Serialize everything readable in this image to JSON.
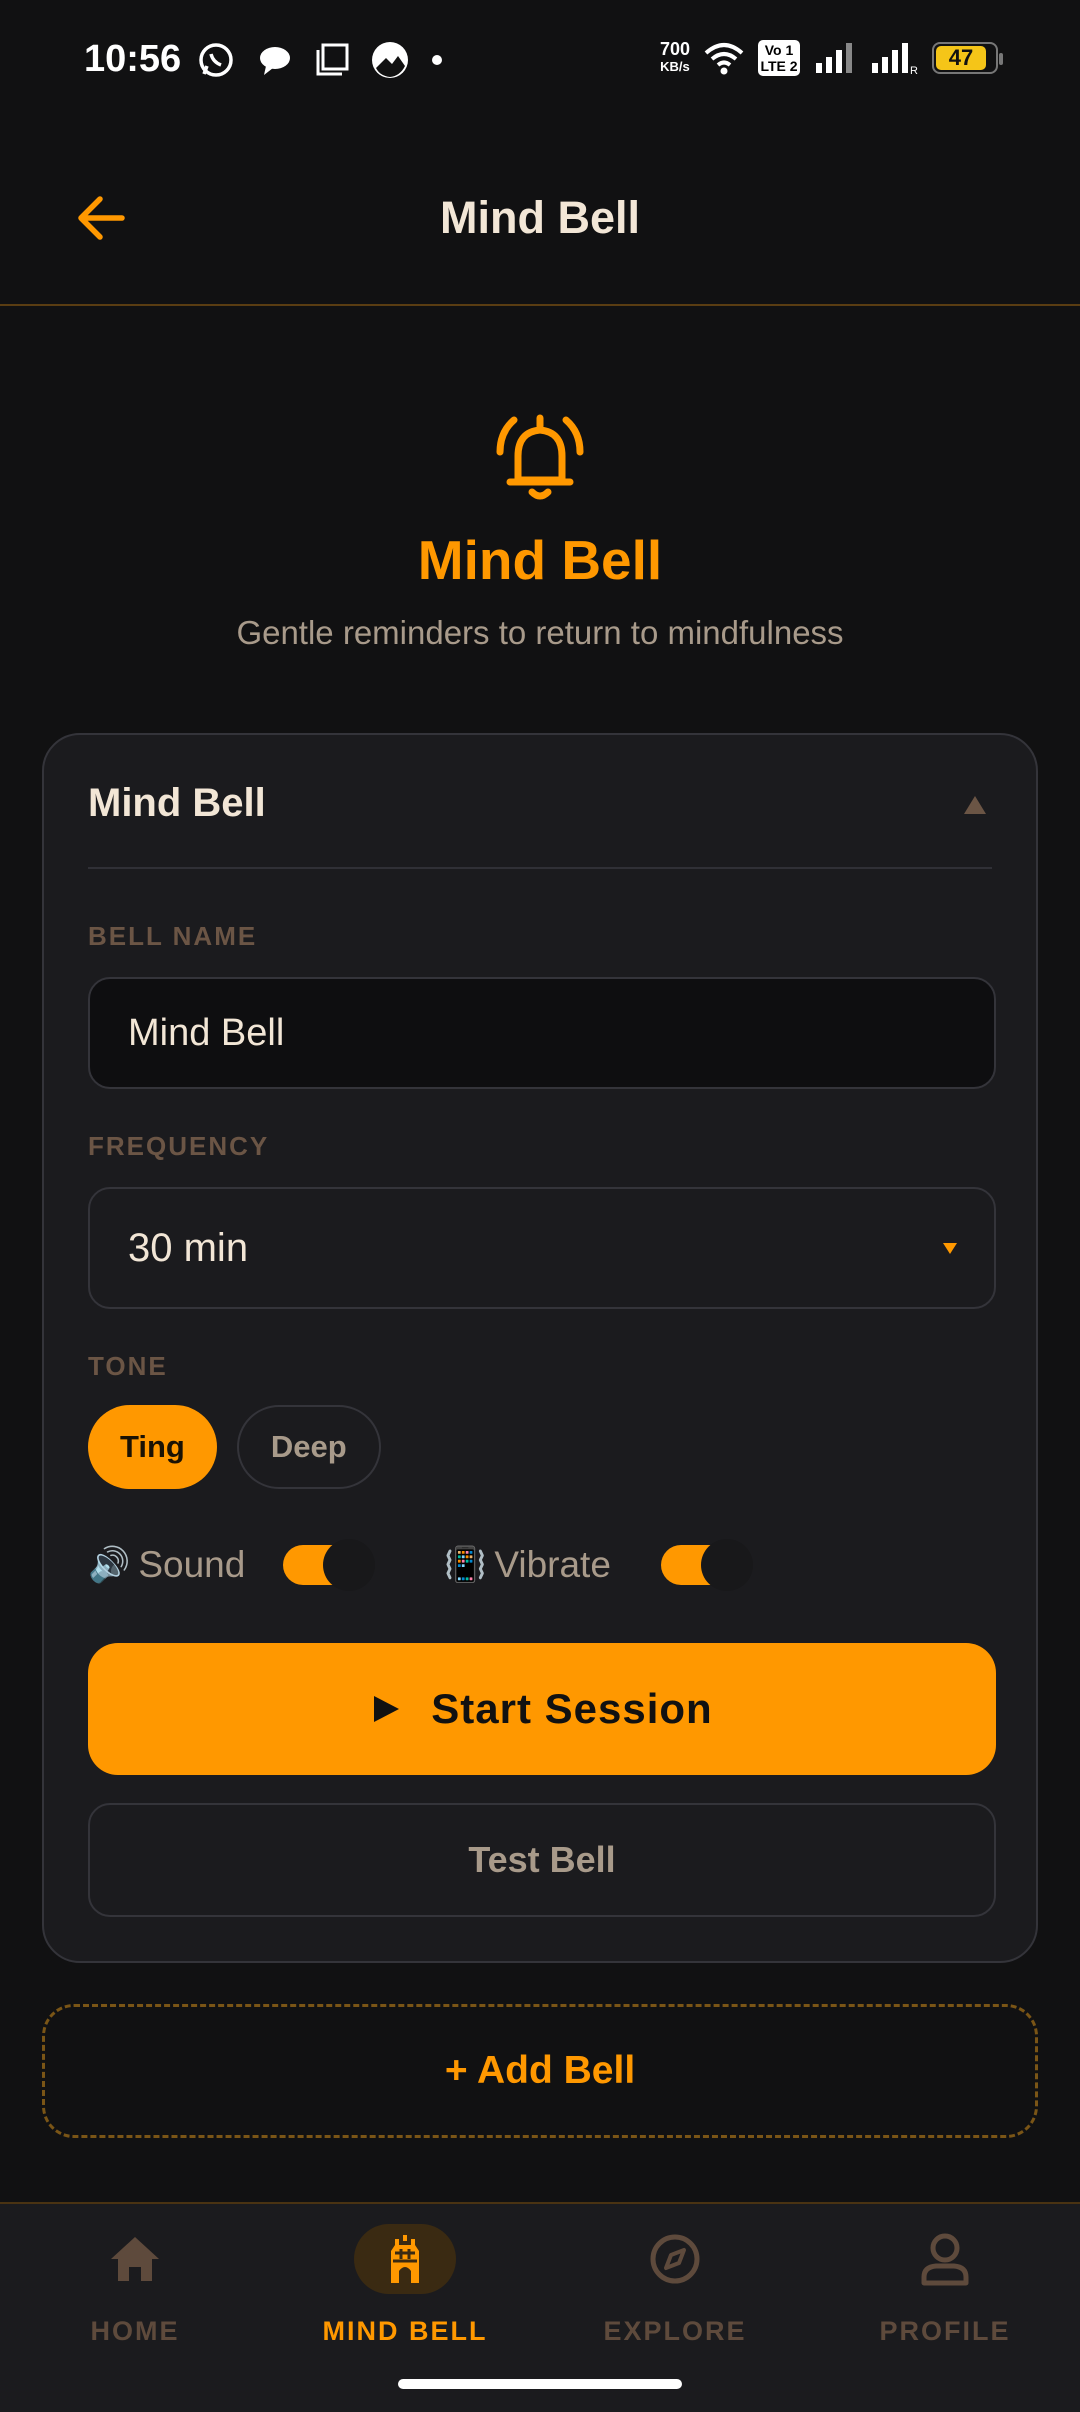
{
  "status_bar": {
    "time": "10:56",
    "data_rate_value": "700",
    "data_rate_unit": "KB/s",
    "volte_top": "Vo 1",
    "volte_bottom": "LTE 2",
    "battery": "47",
    "icons_left": [
      "whatsapp-icon",
      "chat-icon",
      "square-icon",
      "gallery-icon",
      "dot-icon"
    ],
    "icons_right": [
      "wifi-icon",
      "signal-icon",
      "signal-roaming-icon",
      "battery-icon"
    ]
  },
  "appbar": {
    "title": "Mind Bell",
    "back_icon": "arrow-left-icon"
  },
  "hero": {
    "icon": "bell-ringing-icon",
    "title": "Mind Bell",
    "subtitle": "Gentle reminders to return to mindfulness"
  },
  "bell_card": {
    "title": "Mind Bell",
    "collapse_icon": "triangle-up-icon",
    "bell_name_label": "BELL NAME",
    "bell_name_value": "Mind Bell",
    "frequency_label": "FREQUENCY",
    "frequency_value": "30 min",
    "tone_label": "TONE",
    "tones": [
      {
        "label": "Ting",
        "selected": true
      },
      {
        "label": "Deep",
        "selected": false
      }
    ],
    "sound": {
      "icon": "🔊",
      "label": "Sound",
      "on": true
    },
    "vibrate": {
      "icon": "📳",
      "label": "Vibrate",
      "on": true
    },
    "start_button": "Start Session",
    "start_icon": "play-icon",
    "test_button": "Test Bell"
  },
  "add_bell": "+ Add Bell",
  "bottom_nav": [
    {
      "label": "HOME",
      "icon": "home-icon",
      "active": false
    },
    {
      "label": "MIND BELL",
      "icon": "temple-icon",
      "active": true
    },
    {
      "label": "EXPLORE",
      "icon": "compass-icon",
      "active": false
    },
    {
      "label": "PROFILE",
      "icon": "person-icon",
      "active": false
    }
  ],
  "colors": {
    "accent": "#FF9800",
    "background": "#111112",
    "card": "#1B1B1E",
    "text_primary": "#F2E6D6",
    "text_muted": "#A89A8A",
    "label_brown": "#6B5545"
  }
}
